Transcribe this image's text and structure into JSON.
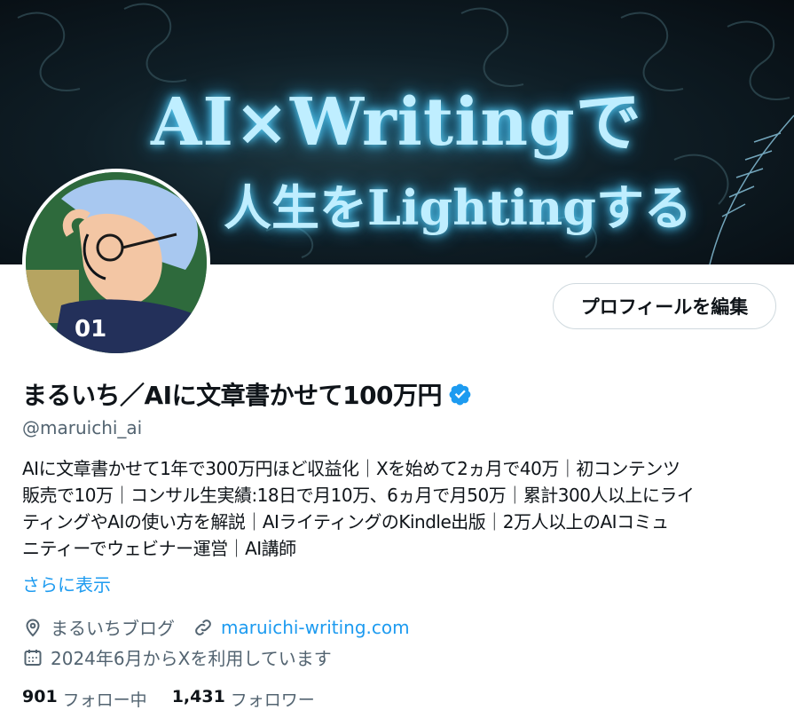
{
  "banner": {
    "line1": "AI×Writingで",
    "line2": "人生をLightingする"
  },
  "profile": {
    "edit_button": "プロフィールを編集",
    "name": "まるいち／AIに文章書かせて100万円",
    "handle": "@maruichi_ai",
    "bio_lines": [
      "AIに文章書かせて1年で300万円ほど収益化｜Xを始めて2ヵ月で40万｜初コンテンツ",
      "販売で10万｜コンサル生実績:18日で月10万、6ヵ月で月50万｜累計300人以上にライ",
      "ティングやAIの使い方を解説｜AIライティングのKindle出版｜2万人以上のAIコミュ",
      "ニティーでウェビナー運営｜AI講師"
    ],
    "show_more": "さらに表示",
    "location": "まるいちブログ",
    "website": "maruichi-writing.com",
    "joined": "2024年6月からXを利用しています",
    "following_count": "901",
    "following_label": "フォロー中",
    "followers_count": "1,431",
    "followers_label": "フォロワー"
  },
  "colors": {
    "accent": "#1d9bf0",
    "secondary_text": "#536471",
    "verified": "#1d9bf0"
  },
  "icons": {
    "verified": "verified-badge-icon",
    "location": "location-pin-icon",
    "website": "link-icon",
    "joined": "calendar-icon"
  }
}
